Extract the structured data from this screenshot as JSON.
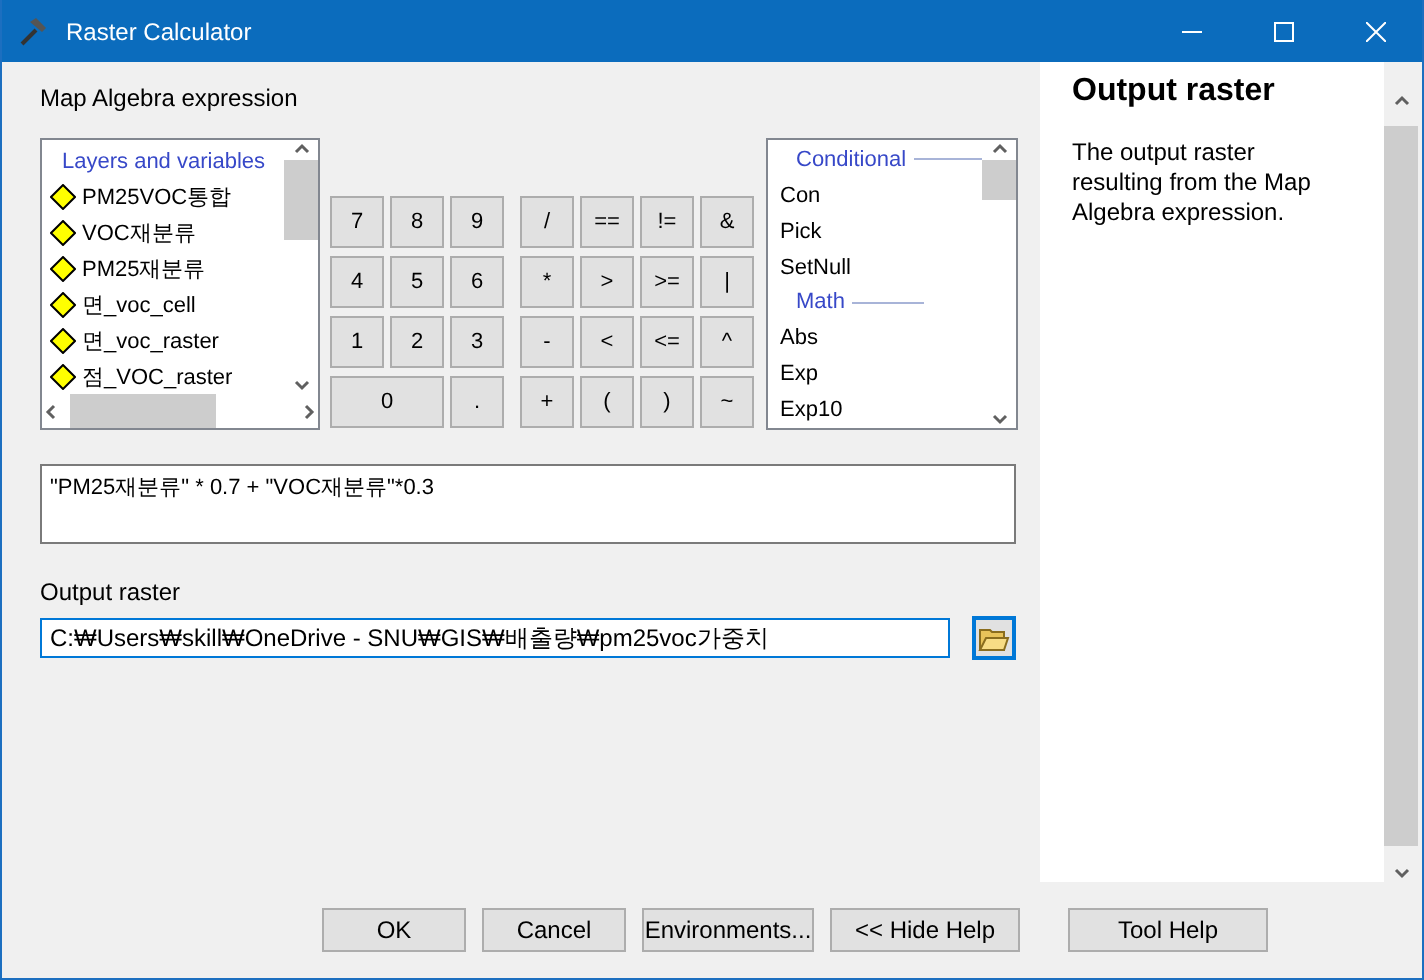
{
  "window": {
    "title": "Raster Calculator"
  },
  "expression_label": "Map Algebra expression",
  "layers": {
    "header": "Layers and variables",
    "items": [
      "PM25VOC통합",
      "VOC재분류",
      "PM25재분류",
      "면_voc_cell",
      "면_voc_raster",
      "점_VOC_raster"
    ]
  },
  "keypad": {
    "digits": [
      {
        "label": "7",
        "wide": false
      },
      {
        "label": "8",
        "wide": false
      },
      {
        "label": "9",
        "wide": false
      },
      {
        "label": "4",
        "wide": false
      },
      {
        "label": "5",
        "wide": false
      },
      {
        "label": "6",
        "wide": false
      },
      {
        "label": "1",
        "wide": false
      },
      {
        "label": "2",
        "wide": false
      },
      {
        "label": "3",
        "wide": false
      },
      {
        "label": "0",
        "wide": true
      },
      {
        "label": ".",
        "wide": false
      }
    ],
    "operators": [
      "/",
      "==",
      "!=",
      "&",
      "*",
      ">",
      ">=",
      "|",
      "-",
      "<",
      "<=",
      "^",
      "+",
      "(",
      ")",
      "~"
    ]
  },
  "functions": {
    "groups": [
      {
        "header": "Conditional",
        "items": [
          "Con",
          "Pick",
          "SetNull"
        ]
      },
      {
        "header": "Math",
        "items": [
          "Abs",
          "Exp",
          "Exp10"
        ]
      }
    ]
  },
  "expression": "\"PM25재분류\" * 0.7 + \"VOC재분류\"*0.3",
  "output": {
    "label": "Output raster",
    "value": "C:₩Users₩skill₩OneDrive - SNU₩GIS₩배출량₩pm25voc가중치"
  },
  "help": {
    "title": "Output raster",
    "body": "The output raster resulting from the Map Algebra expression."
  },
  "buttons": [
    "OK",
    "Cancel",
    "Environments...",
    "<< Hide Help",
    "Tool Help"
  ]
}
